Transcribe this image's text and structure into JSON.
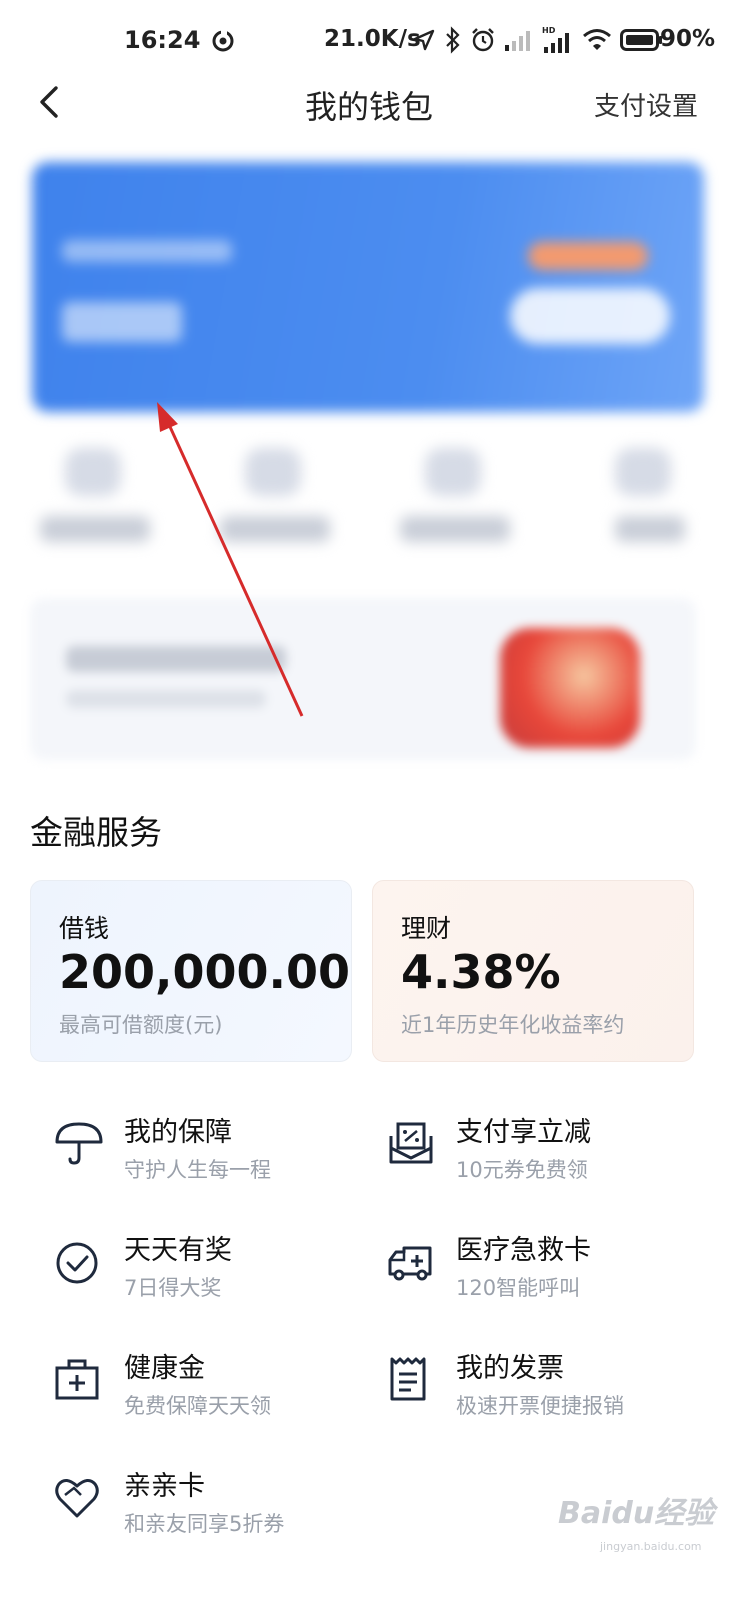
{
  "status_bar": {
    "time": "16:24",
    "net_speed": "21.0K/s",
    "battery_pct": "90%",
    "icons": [
      "network-activity-icon",
      "location-icon",
      "bluetooth-icon",
      "alarm-icon",
      "signal-icon",
      "hd-signal-icon",
      "wifi-icon",
      "battery-icon"
    ]
  },
  "nav": {
    "title": "我的钱包",
    "right_action": "支付设置"
  },
  "finance": {
    "section_title": "金融服务",
    "borrow": {
      "label": "借钱",
      "value": "200,000.00",
      "note": "最高可借额度(元)"
    },
    "invest": {
      "label": "理财",
      "value": "4.38%",
      "note": "近1年历史年化收益率约"
    }
  },
  "services": [
    {
      "title": "我的保障",
      "subtitle": "守护人生每一程",
      "icon": "umbrella-icon"
    },
    {
      "title": "支付享立减",
      "subtitle": "10元券免费领",
      "icon": "coupon-envelope-icon"
    },
    {
      "title": "天天有奖",
      "subtitle": "7日得大奖",
      "icon": "check-circle-icon"
    },
    {
      "title": "医疗急救卡",
      "subtitle": "120智能呼叫",
      "icon": "ambulance-icon"
    },
    {
      "title": "健康金",
      "subtitle": "免费保障天天领",
      "icon": "medical-kit-icon"
    },
    {
      "title": "我的发票",
      "subtitle": "极速开票便捷报销",
      "icon": "invoice-icon"
    },
    {
      "title": "亲亲卡",
      "subtitle": "和亲友同享5折券",
      "icon": "heart-icon"
    }
  ],
  "watermark": {
    "text": "Baidu经验",
    "sub": "jingyan.baidu.com"
  },
  "colors": {
    "card_blue": "#4a8bef",
    "arrow_red": "#d62b2b",
    "icon_dark": "#1f2a3d",
    "muted_text": "#9aa0aa"
  }
}
